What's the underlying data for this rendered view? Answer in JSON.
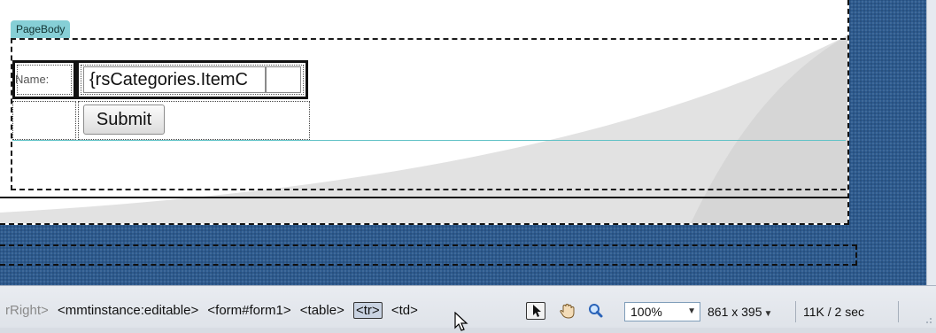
{
  "region": {
    "tab_label": "PageBody"
  },
  "form": {
    "name_label": "Name:",
    "name_value": "{rsCategories.ItemC",
    "submit_label": "Submit"
  },
  "statusbar": {
    "tags": [
      {
        "label": "rRight>",
        "faded": true
      },
      {
        "label": "<mmtinstance:editable>"
      },
      {
        "label": "<form#form1>"
      },
      {
        "label": "<table>"
      },
      {
        "label": "<tr>",
        "selected": true
      },
      {
        "label": "<td>"
      }
    ],
    "zoom": "100%",
    "window_size": "861 x 395",
    "download": "11K / 2 sec"
  },
  "icons": [
    "pointer-icon",
    "hand-icon",
    "zoom-icon",
    "chevron-down-icon",
    "resize-grip-icon",
    "mouse-cursor-icon"
  ],
  "colors": {
    "canvas_blue": "#2d5a8e",
    "region_tab": "#86cfd6",
    "guide_line": "#62c2c6"
  }
}
